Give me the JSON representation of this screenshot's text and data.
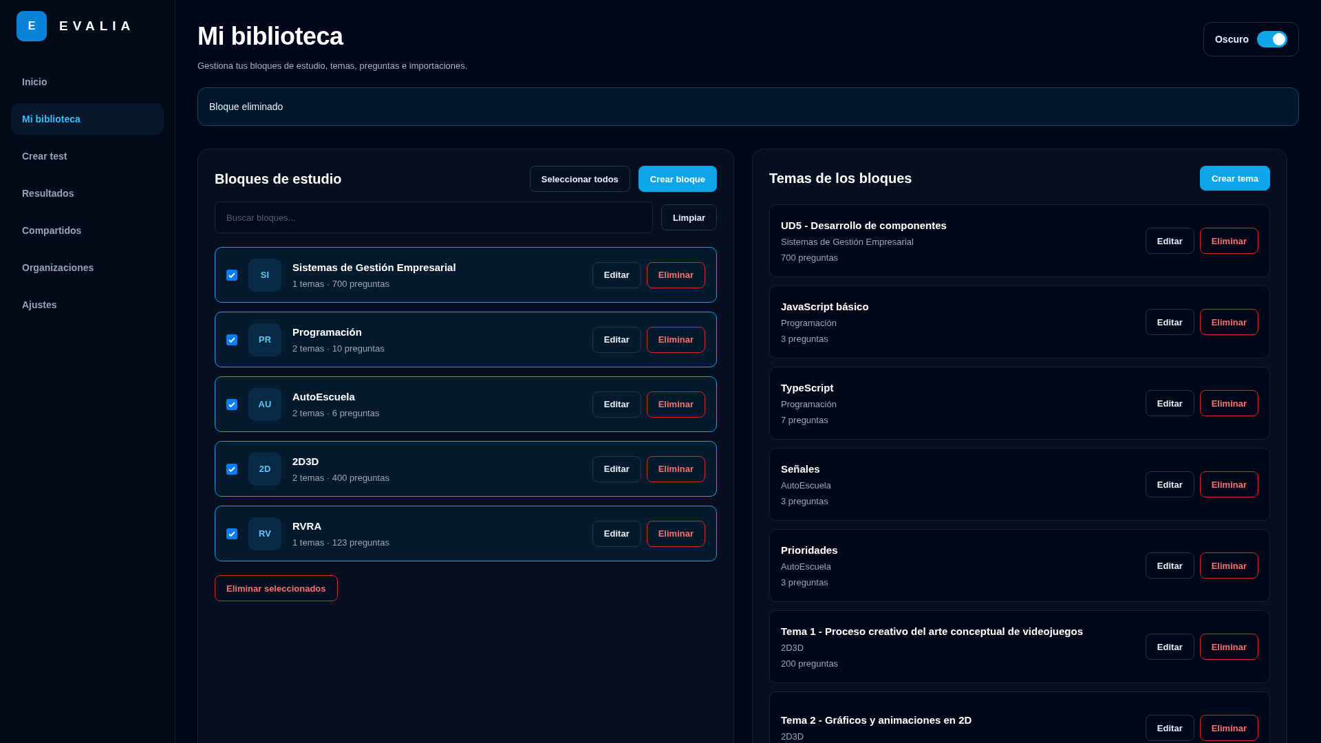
{
  "brand": {
    "logo_letter": "E",
    "name": "EVALIA"
  },
  "sidebar": {
    "items": [
      {
        "label": "Inicio",
        "selected": false
      },
      {
        "label": "Mi biblioteca",
        "selected": true
      },
      {
        "label": "Crear test",
        "selected": false
      },
      {
        "label": "Resultados",
        "selected": false
      },
      {
        "label": "Compartidos",
        "selected": false
      },
      {
        "label": "Organizaciones",
        "selected": false
      },
      {
        "label": "Ajustes",
        "selected": false
      }
    ]
  },
  "header": {
    "title": "Mi biblioteca",
    "subtitle": "Gestiona tus bloques de estudio, temas, preguntas e importaciones.",
    "theme_toggle": {
      "label": "Oscuro",
      "on": true
    }
  },
  "alert": "Bloque eliminado",
  "blocks_panel": {
    "title": "Bloques de estudio",
    "select_all": "Seleccionar todos",
    "create": "Crear bloque",
    "search": {
      "placeholder": "Buscar bloques..."
    },
    "clear": "Limpiar",
    "delete_selected": "Eliminar seleccionados",
    "blocks": [
      {
        "initials": "SI",
        "name": "Sistemas de Gestión Empresarial",
        "meta": "1 temas · 700 preguntas",
        "checked": true,
        "edit": "Editar",
        "delete": "Eliminar"
      },
      {
        "initials": "PR",
        "name": "Programación",
        "meta": "2 temas · 10 preguntas",
        "checked": true,
        "edit": "Editar",
        "delete": "Eliminar"
      },
      {
        "initials": "AU",
        "name": "AutoEscuela",
        "meta": "2 temas · 6 preguntas",
        "checked": true,
        "edit": "Editar",
        "delete": "Eliminar"
      },
      {
        "initials": "2D",
        "name": "2D3D",
        "meta": "2 temas · 400 preguntas",
        "checked": true,
        "edit": "Editar",
        "delete": "Eliminar"
      },
      {
        "initials": "RV",
        "name": "RVRA",
        "meta": "1 temas · 123 preguntas",
        "checked": true,
        "edit": "Editar",
        "delete": "Eliminar"
      }
    ]
  },
  "topics_panel": {
    "title": "Temas de los bloques",
    "create": "Crear tema",
    "topics": [
      {
        "title": "UD5 - Desarrollo de componentes",
        "block": "Sistemas de Gestión Empresarial",
        "count": "700 preguntas",
        "edit": "Editar",
        "delete": "Eliminar"
      },
      {
        "title": "JavaScript básico",
        "block": "Programación",
        "count": "3 preguntas",
        "edit": "Editar",
        "delete": "Eliminar"
      },
      {
        "title": "TypeScript",
        "block": "Programación",
        "count": "7 preguntas",
        "edit": "Editar",
        "delete": "Eliminar"
      },
      {
        "title": "Señales",
        "block": "AutoEscuela",
        "count": "3 preguntas",
        "edit": "Editar",
        "delete": "Eliminar"
      },
      {
        "title": "Prioridades",
        "block": "AutoEscuela",
        "count": "3 preguntas",
        "edit": "Editar",
        "delete": "Eliminar"
      },
      {
        "title": "Tema 1 - Proceso creativo del arte conceptual de videojuegos",
        "block": "2D3D",
        "count": "200 preguntas",
        "edit": "Editar",
        "delete": "Eliminar"
      },
      {
        "title": "Tema 2 - Gráficos y animaciones en 2D",
        "block": "2D3D",
        "edit": "Editar",
        "delete": "Eliminar"
      }
    ]
  }
}
